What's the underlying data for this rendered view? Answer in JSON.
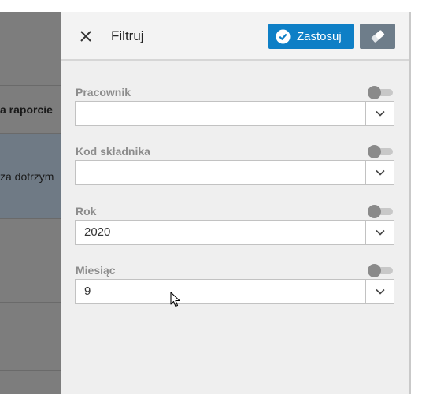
{
  "background": {
    "row_header_fragment": "a raporcie",
    "row_cell_fragment": "za dotrzym"
  },
  "panel": {
    "title": "Filtruj",
    "apply_label": "Zastosuj",
    "fields": [
      {
        "label": "Pracownik",
        "value": ""
      },
      {
        "label": "Kod składnika",
        "value": ""
      },
      {
        "label": "Rok",
        "value": "2020"
      },
      {
        "label": "Miesiąc",
        "value": "9"
      }
    ]
  },
  "colors": {
    "apply_button": "#0e7fc6",
    "clear_button": "#6e7d8a",
    "panel_bg": "#efefef"
  },
  "icons": {
    "close": "close-icon",
    "apply": "check-circle-icon",
    "clear": "eraser-icon",
    "dropdown": "chevron-down-icon"
  }
}
